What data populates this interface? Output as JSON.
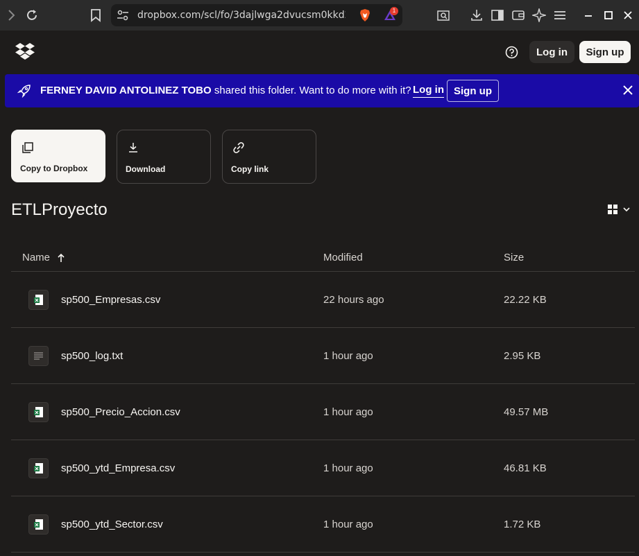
{
  "browser": {
    "url": "dropbox.com/scl/fo/3dajlwga2dvucsm0kkd2...",
    "badge_count": "1"
  },
  "header": {
    "login_label": "Log in",
    "signup_label": "Sign up"
  },
  "banner": {
    "sharer": "FERNEY DAVID ANTOLINEZ TOBO",
    "message": " shared this folder. Want to do more with it?",
    "login_label": "Log in",
    "signup_label": "Sign up",
    "bg_color": "#1a0ba6"
  },
  "actions": {
    "copy_label": "Copy to Dropbox",
    "download_label": "Download",
    "copylink_label": "Copy link"
  },
  "folder": {
    "title": "ETLProyecto"
  },
  "table": {
    "col_name": "Name",
    "col_modified": "Modified",
    "col_size": "Size",
    "rows": [
      {
        "name": "sp500_Empresas.csv",
        "modified": "22 hours ago",
        "size": "22.22 KB",
        "type": "excel-icon"
      },
      {
        "name": "sp500_log.txt",
        "modified": "1 hour ago",
        "size": "2.95 KB",
        "type": "text-file-icon"
      },
      {
        "name": "sp500_Precio_Accion.csv",
        "modified": "1 hour ago",
        "size": "49.57 MB",
        "type": "excel-icon"
      },
      {
        "name": "sp500_ytd_Empresa.csv",
        "modified": "1 hour ago",
        "size": "46.81 KB",
        "type": "excel-icon"
      },
      {
        "name": "sp500_ytd_Sector.csv",
        "modified": "1 hour ago",
        "size": "1.72 KB",
        "type": "excel-icon"
      }
    ]
  }
}
